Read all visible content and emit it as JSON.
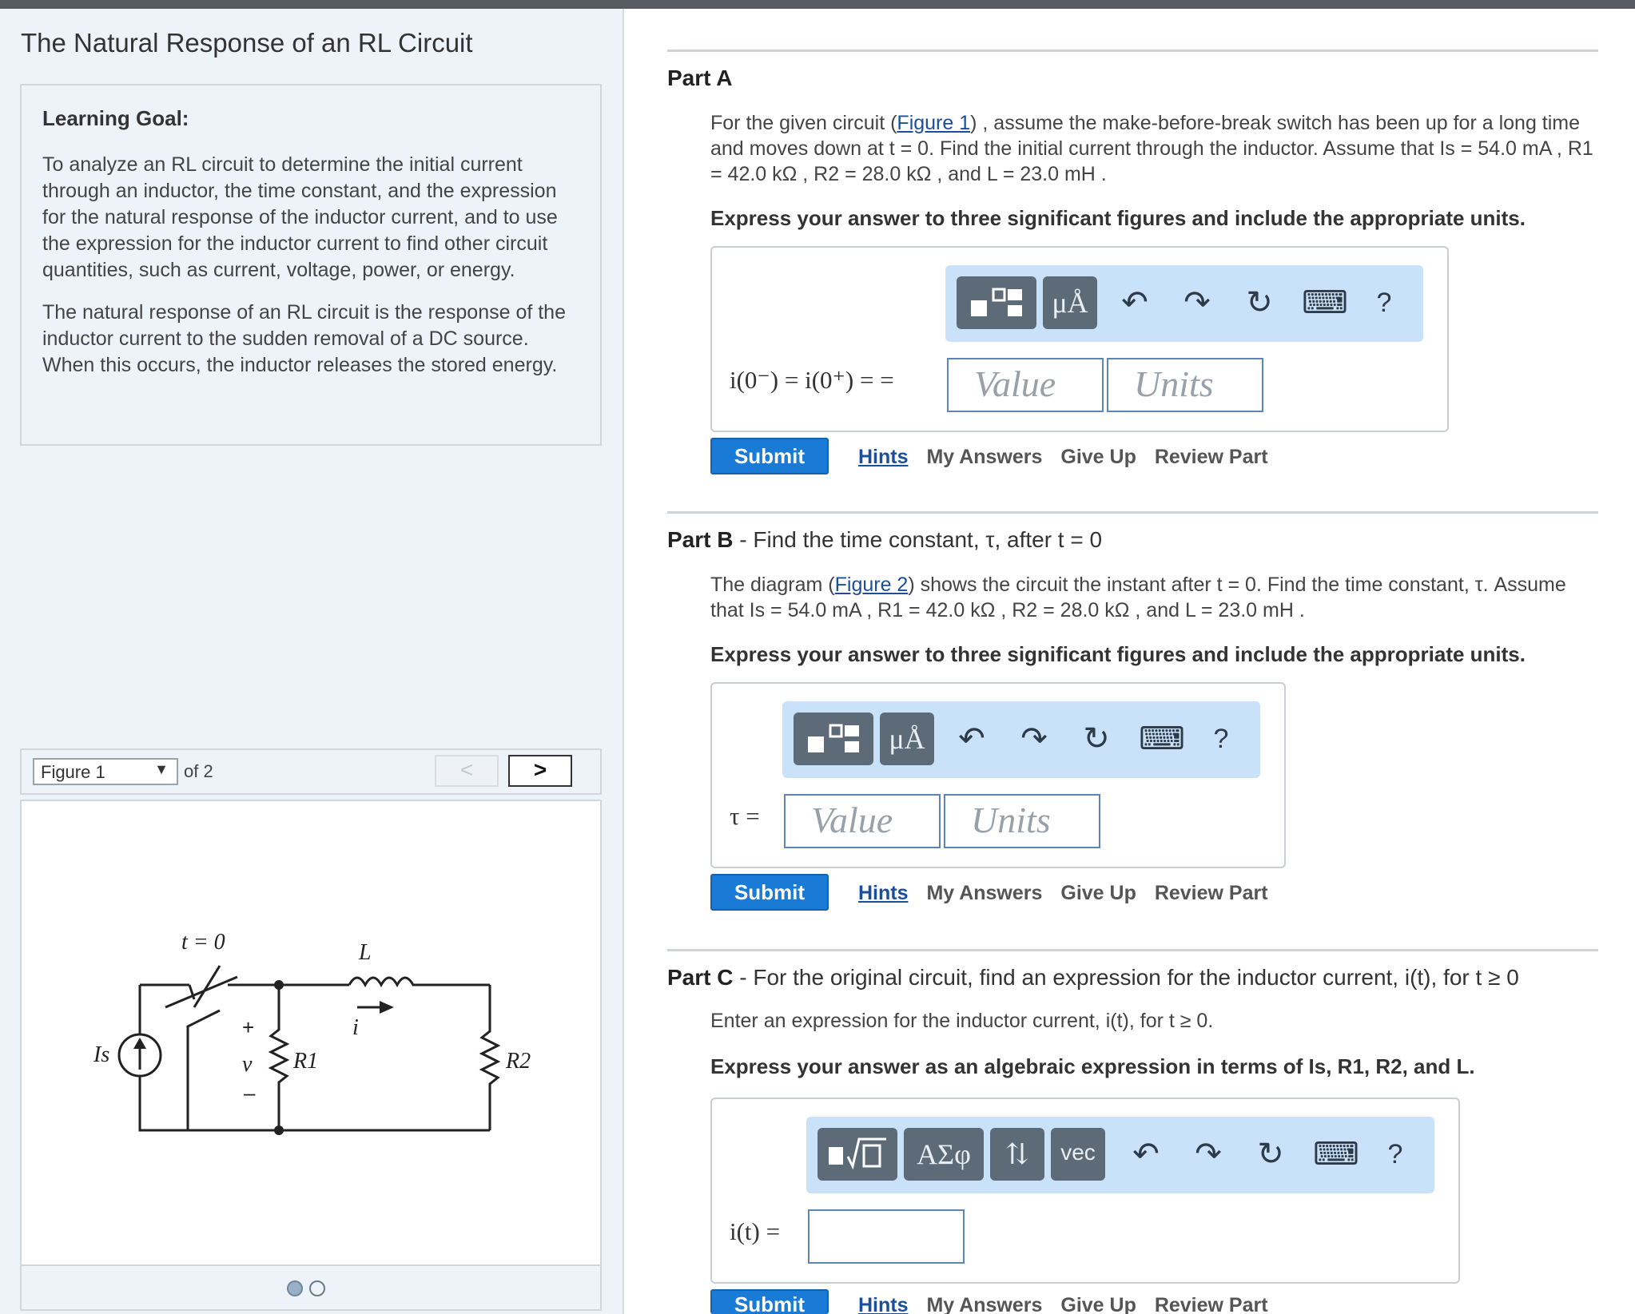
{
  "page": {
    "title": "The Natural Response of an RL Circuit"
  },
  "learning_goal": {
    "title": "Learning Goal:",
    "para1": "To analyze an RL circuit to determine the initial current through an inductor, the time constant, and the expression for the natural response of the inductor current, and to use the expression for the inductor current to find other circuit quantities, such as current, voltage, power, or energy.",
    "para2": "The natural response of an RL circuit is the response of the inductor current to the sudden removal of a DC source. When this occurs, the inductor releases the stored energy."
  },
  "figure_nav": {
    "selected": "Figure 1",
    "of_text": "of 2",
    "prev": "<",
    "next": ">"
  },
  "circuit": {
    "switch_label": "t = 0",
    "inductor_label": "L",
    "current_label": "i",
    "source_label": "Is",
    "voltage_label": "v",
    "plus": "+",
    "minus": "–",
    "r1_label": "R1",
    "r2_label": "R2"
  },
  "toolbar": {
    "templates_icon": "templates-icon",
    "units_glyph": "μÅ",
    "greek_glyph": "ΑΣφ",
    "arrows_glyph": "⇅",
    "vec_label": "vec",
    "undo": "↶",
    "redo": "↷",
    "reset": "↻",
    "keyboard": "⌨",
    "help": "?"
  },
  "part_a": {
    "label": "Part A",
    "text_before_link": "For the given circuit (",
    "link": "Figure 1",
    "text_after_link": ") , assume the make-before-break switch has been up for a long time and moves down at t = 0. Find the initial current through the inductor. Assume that Is = 54.0 mA , R1 = 42.0 kΩ , R2 = 28.0 kΩ , and L = 23.0 mH .",
    "instruction": "Express your answer to three significant figures and include the appropriate units.",
    "equation": "i(0⁻) = i(0⁺) = =",
    "value_placeholder": "Value",
    "units_placeholder": "Units"
  },
  "part_b": {
    "label": "Part B",
    "subtitle": " - Find the time constant, τ, after t = 0",
    "text_before_link": "The diagram (",
    "link": "Figure 2",
    "text_after_link": ") shows the circuit the instant after t = 0. Find the time constant, τ. Assume that Is = 54.0 mA , R1 = 42.0 kΩ , R2 = 28.0 kΩ , and L = 23.0 mH .",
    "instruction": "Express your answer to three significant figures and include the appropriate units.",
    "equation": "τ =",
    "value_placeholder": "Value",
    "units_placeholder": "Units"
  },
  "part_c": {
    "label": "Part C",
    "subtitle": " - For the original circuit, find an expression for the inductor current, i(t), for t ≥ 0",
    "text": "Enter an expression for the inductor current, i(t), for t ≥ 0.",
    "instruction": "Express your answer as an algebraic expression in terms of Is, R1, R2, and L.",
    "equation": "i(t) ="
  },
  "actions": {
    "submit": "Submit",
    "hints": "Hints",
    "my_answers": "My Answers",
    "give_up": "Give Up",
    "review_part": "Review Part"
  }
}
